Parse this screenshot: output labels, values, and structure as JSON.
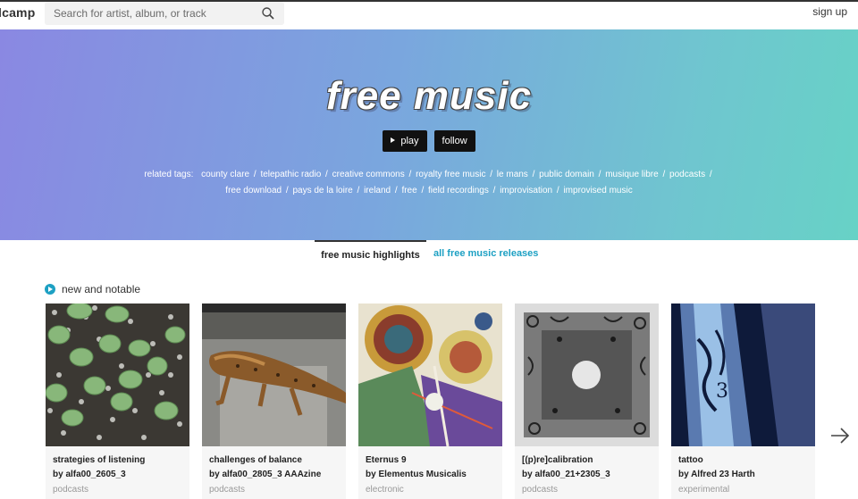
{
  "header": {
    "logo": "lcamp",
    "search_placeholder": "Search for artist, album, or track",
    "signup": "sign up"
  },
  "hero": {
    "title": "free music",
    "play_label": "play",
    "follow_label": "follow",
    "related_label": "related tags:",
    "tags": [
      "county clare",
      "telepathic radio",
      "creative commons",
      "royalty free music",
      "le mans",
      "public domain",
      "musique libre",
      "podcasts",
      "free download",
      "pays de la loire",
      "ireland",
      "free",
      "field recordings",
      "improvisation",
      "improvised music"
    ]
  },
  "tabs": {
    "active": "free music highlights",
    "other": "all free music releases"
  },
  "new_notable": {
    "label": "new and notable",
    "items": [
      {
        "title": "strategies of listening",
        "artist": "by alfa00_2605_3",
        "genre": "podcasts"
      },
      {
        "title": "challenges of balance",
        "artist": "by alfa00_2805_3 AAAzine",
        "genre": "podcasts"
      },
      {
        "title": "Eternus 9",
        "artist": "by Elementus Musicalis",
        "genre": "electronic"
      },
      {
        "title": "[(p)re]calibration",
        "artist": "by alfa00_21+2305_3",
        "genre": "podcasts"
      },
      {
        "title": "tattoo",
        "artist": "by Alfred 23 Harth",
        "genre": "experimental"
      }
    ]
  },
  "colors": {
    "accent": "#1da0c3",
    "hero_gradient_start": "#8a88e2",
    "hero_gradient_end": "#67d2c6"
  },
  "icons": [
    "search-icon",
    "play-icon",
    "next-arrow-icon"
  ]
}
